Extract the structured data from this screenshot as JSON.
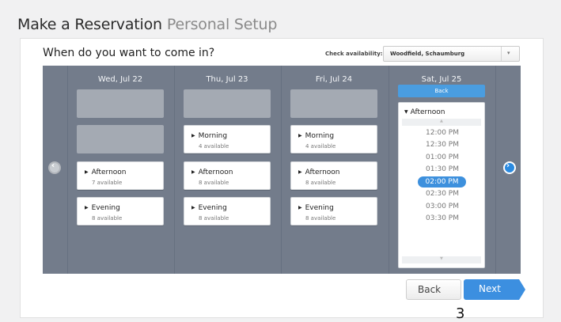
{
  "header": {
    "title": "Make a Reservation",
    "subtitle": "Personal Setup"
  },
  "question": "When do you want to come in?",
  "availability": {
    "label": "Check availability:",
    "location": "Woodfield, Schaumburg"
  },
  "days": [
    {
      "label": "Wed, Jul 22",
      "slots": [
        {
          "title": "Afternoon",
          "count": "7 available"
        },
        {
          "title": "Evening",
          "count": "8 available"
        }
      ]
    },
    {
      "label": "Thu, Jul 23",
      "slots": [
        {
          "title": "Morning",
          "count": "4 available"
        },
        {
          "title": "Afternoon",
          "count": "8 available"
        },
        {
          "title": "Evening",
          "count": "8 available"
        }
      ]
    },
    {
      "label": "Fri, Jul 24",
      "slots": [
        {
          "title": "Morning",
          "count": "4 available"
        },
        {
          "title": "Afternoon",
          "count": "8 available"
        },
        {
          "title": "Evening",
          "count": "8 available"
        }
      ]
    },
    {
      "label": "Sat, Jul 25",
      "back": "Back",
      "section": "Afternoon",
      "times": [
        "12:00 PM",
        "12:30 PM",
        "01:00 PM",
        "01:30 PM",
        "02:00 PM",
        "02:30 PM",
        "03:00 PM",
        "03:30 PM"
      ],
      "selected": "02:00 PM"
    }
  ],
  "buttons": {
    "back": "Back",
    "next": "Next"
  },
  "page_number": "3",
  "colors": {
    "accent": "#3c8fe0",
    "stage": "#737c8b"
  }
}
